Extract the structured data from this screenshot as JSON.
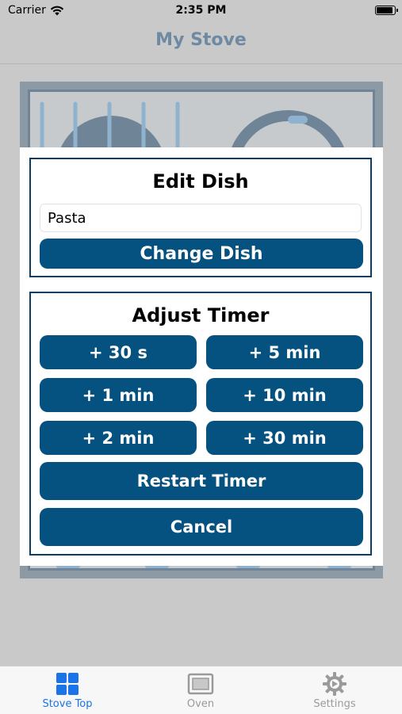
{
  "status_bar": {
    "carrier": "Carrier",
    "time": "2:35 PM"
  },
  "navbar": {
    "title": "My Stove"
  },
  "modal": {
    "edit_dish": {
      "title": "Edit Dish",
      "dish_value": "Pasta",
      "change_button": "Change Dish"
    },
    "adjust_timer": {
      "title": "Adjust Timer",
      "buttons": [
        "+ 30 s",
        "+ 5 min",
        "+ 1 min",
        "+ 10 min",
        "+ 2 min",
        "+ 30 min"
      ],
      "restart_button": "Restart Timer",
      "cancel_button": "Cancel"
    }
  },
  "tabbar": {
    "tabs": [
      {
        "label": "Stove Top",
        "icon": "grid-icon",
        "active": true
      },
      {
        "label": "Oven",
        "icon": "oven-icon",
        "active": false
      },
      {
        "label": "Settings",
        "icon": "gear-icon",
        "active": false
      }
    ]
  },
  "colors": {
    "accent": "#05517f",
    "border": "#0a3e66",
    "tab_active": "#1a73e8",
    "title": "#6e8aa3"
  }
}
